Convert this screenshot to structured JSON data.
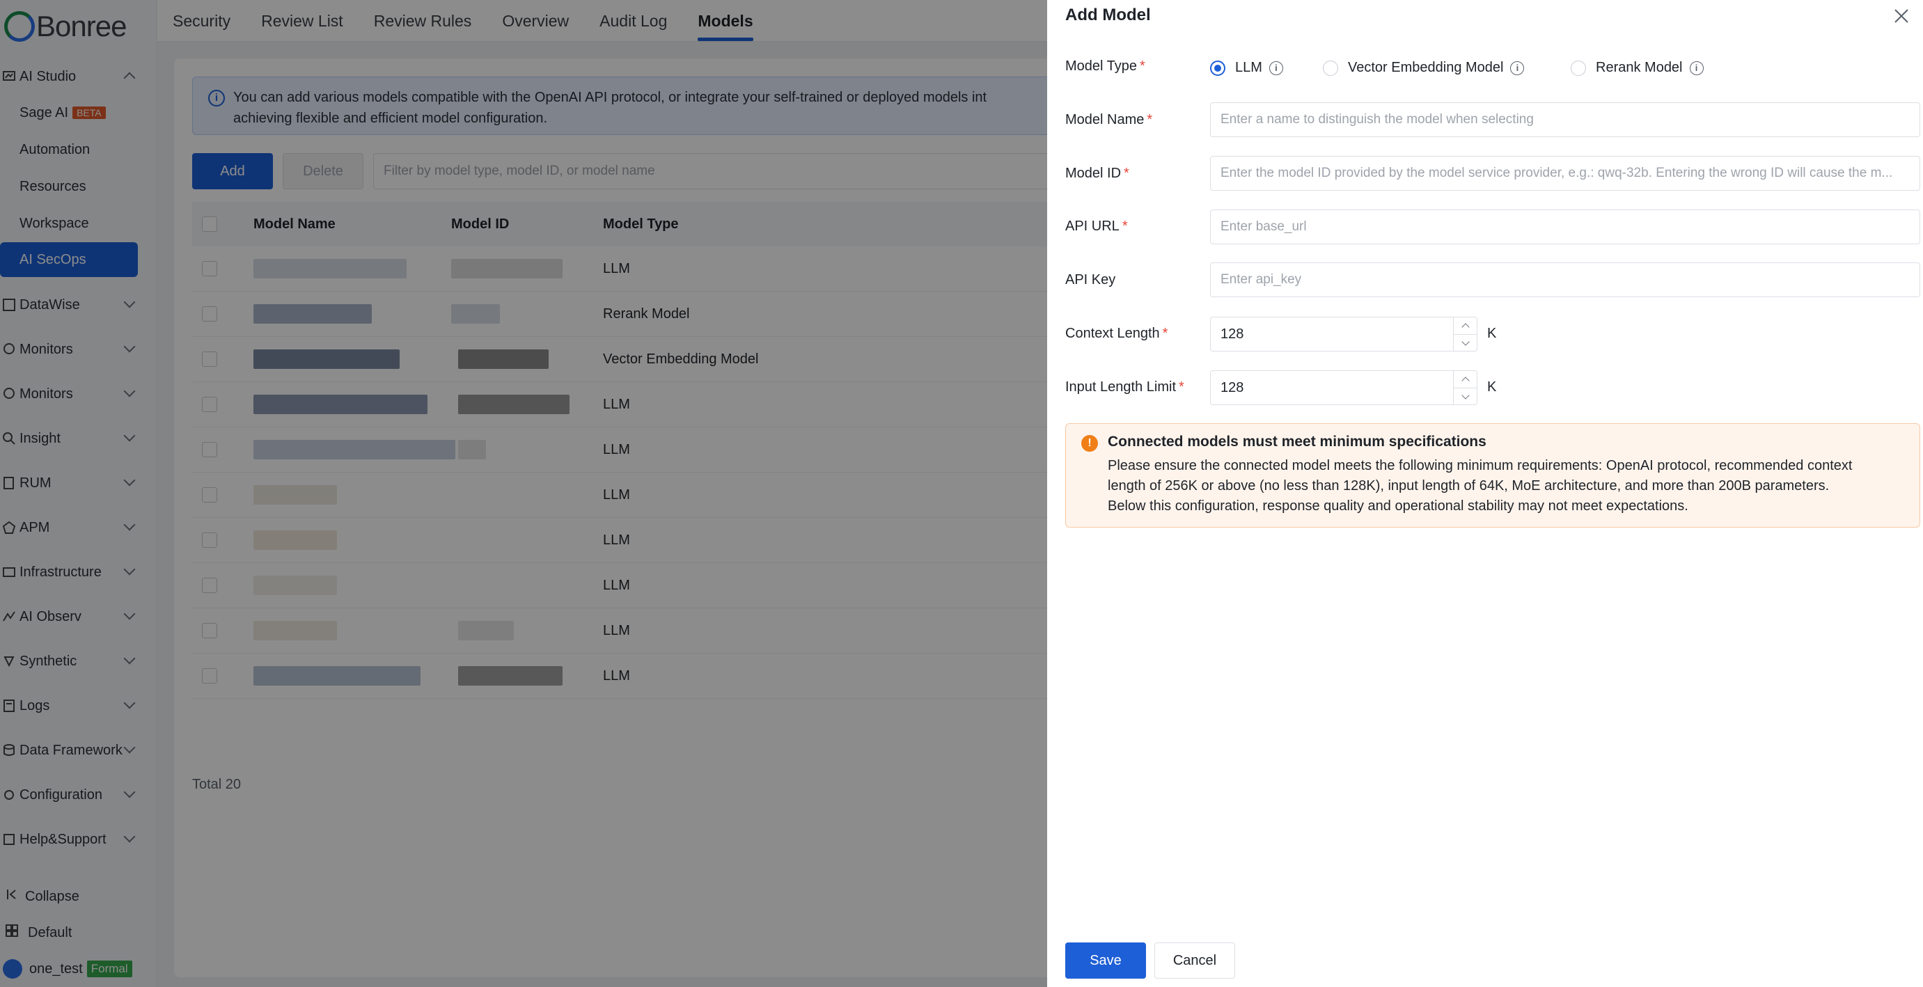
{
  "brand": {
    "logo_text": "Bonree"
  },
  "sidebar": {
    "ai_studio": "AI Studio",
    "sub_items": [
      {
        "label": "Sage AI",
        "badge": "BETA"
      },
      {
        "label": "Automation"
      },
      {
        "label": "Resources"
      },
      {
        "label": "Workspace"
      },
      {
        "label": "AI SecOps"
      }
    ],
    "sections": [
      "DataWise",
      "Monitors",
      "Monitors",
      "Insight",
      "RUM",
      "APM",
      "Infrastructure",
      "AI Observ",
      "Synthetic",
      "Logs",
      "Data Framework",
      "Configuration",
      "Help&Support"
    ],
    "collapse_label": "Collapse",
    "workspace_label": "Default",
    "user_name": "one_test",
    "user_badge": "Formal"
  },
  "topnav": {
    "tabs": [
      "Security",
      "Review List",
      "Review Rules",
      "Overview",
      "Audit Log",
      "Models"
    ],
    "active": "Models"
  },
  "main": {
    "info_text_line1": "You can add various models compatible with the OpenAI API protocol, or integrate your self-trained or deployed models int",
    "info_text_line2": "achieving flexible and efficient model configuration.",
    "add_button": "Add",
    "delete_button": "Delete",
    "filter_placeholder": "Filter by model type, model ID, or model name",
    "columns": [
      "Model Name",
      "Model ID",
      "Model Type"
    ],
    "rows": [
      "LLM",
      "Rerank Model",
      "Vector Embedding Model",
      "LLM",
      "LLM",
      "LLM",
      "LLM",
      "LLM",
      "LLM",
      "LLM"
    ],
    "total": "Total 20"
  },
  "drawer": {
    "title": "Add Model",
    "model_type_label": "Model Type",
    "model_type_options": [
      "LLM",
      "Vector Embedding Model",
      "Rerank Model"
    ],
    "model_type_selected": "LLM",
    "model_name_label": "Model Name",
    "model_name_placeholder": "Enter a name to distinguish the model when selecting",
    "model_id_label": "Model ID",
    "model_id_placeholder": "Enter the model ID provided by the model service provider, e.g.: qwq-32b. Entering the wrong ID will cause the m...",
    "api_url_label": "API URL",
    "api_url_placeholder": "Enter base_url",
    "api_key_label": "API Key",
    "api_key_placeholder": "Enter api_key",
    "context_length_label": "Context Length",
    "context_length_value": "128",
    "input_limit_label": "Input Length Limit",
    "input_limit_value": "128",
    "unit": "K",
    "warning_title": "Connected models must meet minimum specifications",
    "warning_line1": "Please ensure the connected model meets the following minimum requirements: OpenAI protocol, recommended context",
    "warning_line2": "length of 256K or above (no less than 128K), input length of 64K, MoE architecture, and more than 200B parameters.",
    "warning_line3": "Below this configuration, response quality and operational stability may not meet expectations.",
    "save_button": "Save",
    "cancel_button": "Cancel"
  },
  "colors": {
    "primary": "#1d5fd6",
    "warning": "#f07f18",
    "required": "#e5463b"
  }
}
